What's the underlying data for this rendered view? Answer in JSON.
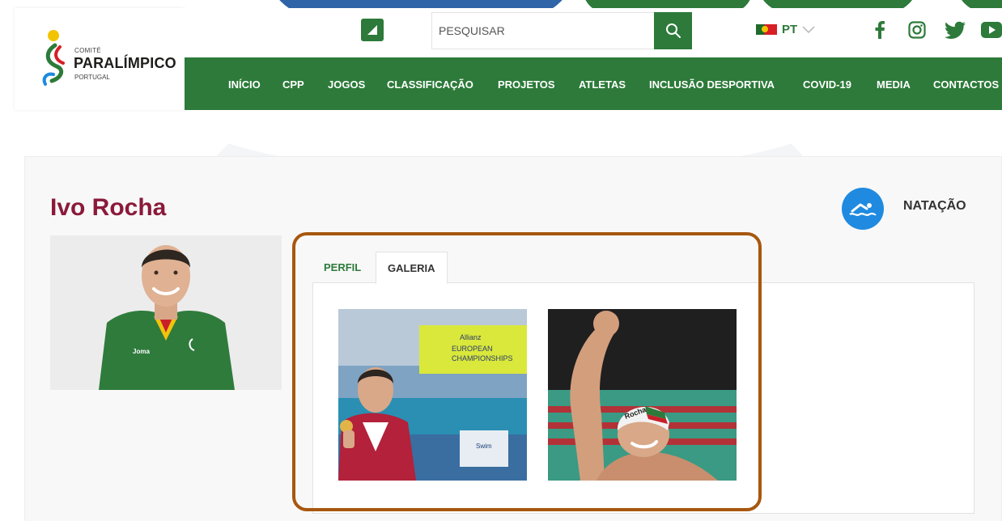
{
  "header": {
    "logo": {
      "line1": "COMITÉ",
      "line2": "PARALÍMPICO",
      "line3": "PORTUGAL"
    },
    "search": {
      "placeholder": "PESQUISAR"
    },
    "language": {
      "selected": "PT"
    },
    "social": [
      "facebook-icon",
      "instagram-icon",
      "twitter-icon",
      "youtube-icon"
    ]
  },
  "nav": {
    "items": [
      "INÍCIO",
      "CPP",
      "JOGOS",
      "CLASSIFICAÇÃO",
      "PROJETOS",
      "ATLETAS",
      "INCLUSÃO DESPORTIVA",
      "COVID-19",
      "MEDIA",
      "CONTACTOS"
    ]
  },
  "athlete": {
    "name": "Ivo Rocha",
    "sport": "NATAÇÃO"
  },
  "tabs": {
    "items": [
      "PERFIL",
      "GALERIA"
    ],
    "active": "GALERIA"
  },
  "gallery": {
    "photo1": {
      "banner_text": [
        "Allianz",
        "EUROPEAN",
        "CHAMPIONSHIPS"
      ],
      "sign_text": "Swim"
    },
    "photo2": {
      "cap_text": "Rocha"
    }
  },
  "colors": {
    "brand_green": "#2d7a3a",
    "name_color": "#8b1a3a",
    "sport_blue": "#1f8ae0",
    "highlight": "#a8570f"
  }
}
